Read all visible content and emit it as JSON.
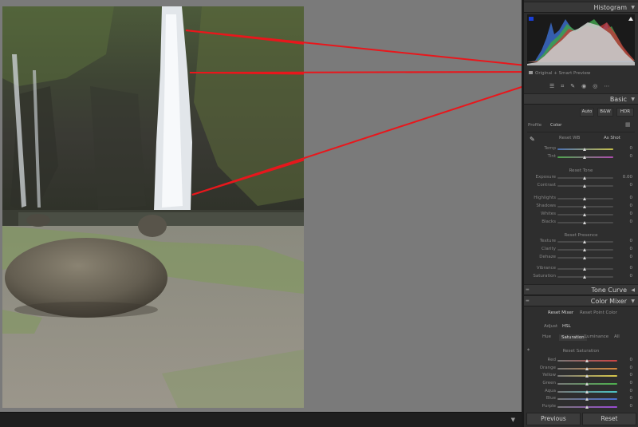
{
  "colors": {
    "accent_red": "#e8171c"
  },
  "histogram": {
    "title": "Histogram",
    "preview_label": "Original + Smart Preview"
  },
  "basic": {
    "title": "Basic",
    "auto": "Auto",
    "bw": "B&W",
    "hdr": "HDR",
    "profile_label": "Profile",
    "profile_value": "Color",
    "reset_wb": "Reset WB",
    "wb_value": "As Shot",
    "reset_tone": "Reset Tone",
    "reset_presence": "Reset Presence",
    "sliders": [
      {
        "label": "Temp",
        "value": "0"
      },
      {
        "label": "Tint",
        "value": "0"
      },
      {
        "label": "Exposure",
        "value": "0.00"
      },
      {
        "label": "Contrast",
        "value": "0"
      },
      {
        "label": "Highlights",
        "value": "0"
      },
      {
        "label": "Shadows",
        "value": "0"
      },
      {
        "label": "Whites",
        "value": "0"
      },
      {
        "label": "Blacks",
        "value": "0"
      },
      {
        "label": "Texture",
        "value": "0"
      },
      {
        "label": "Clarity",
        "value": "0"
      },
      {
        "label": "Dehaze",
        "value": "0"
      },
      {
        "label": "Vibrance",
        "value": "0"
      },
      {
        "label": "Saturation",
        "value": "0"
      }
    ]
  },
  "tone_curve": {
    "title": "Tone Curve"
  },
  "color_mixer": {
    "title": "Color Mixer",
    "reset_mixer": "Reset Mixer",
    "reset_point_color": "Reset Point Color",
    "adjust_label": "Adjust",
    "adjust_value": "HSL",
    "tabs": [
      "Hue",
      "Saturation",
      "Luminance",
      "All"
    ],
    "reset_saturation": "Reset Saturation",
    "colors": [
      {
        "label": "Red",
        "value": "0"
      },
      {
        "label": "Orange",
        "value": "0"
      },
      {
        "label": "Yellow",
        "value": "0"
      },
      {
        "label": "Green",
        "value": "0"
      },
      {
        "label": "Aqua",
        "value": "0"
      },
      {
        "label": "Blue",
        "value": "0"
      },
      {
        "label": "Purple",
        "value": "0"
      }
    ]
  },
  "footer": {
    "previous": "Previous",
    "reset": "Reset"
  }
}
